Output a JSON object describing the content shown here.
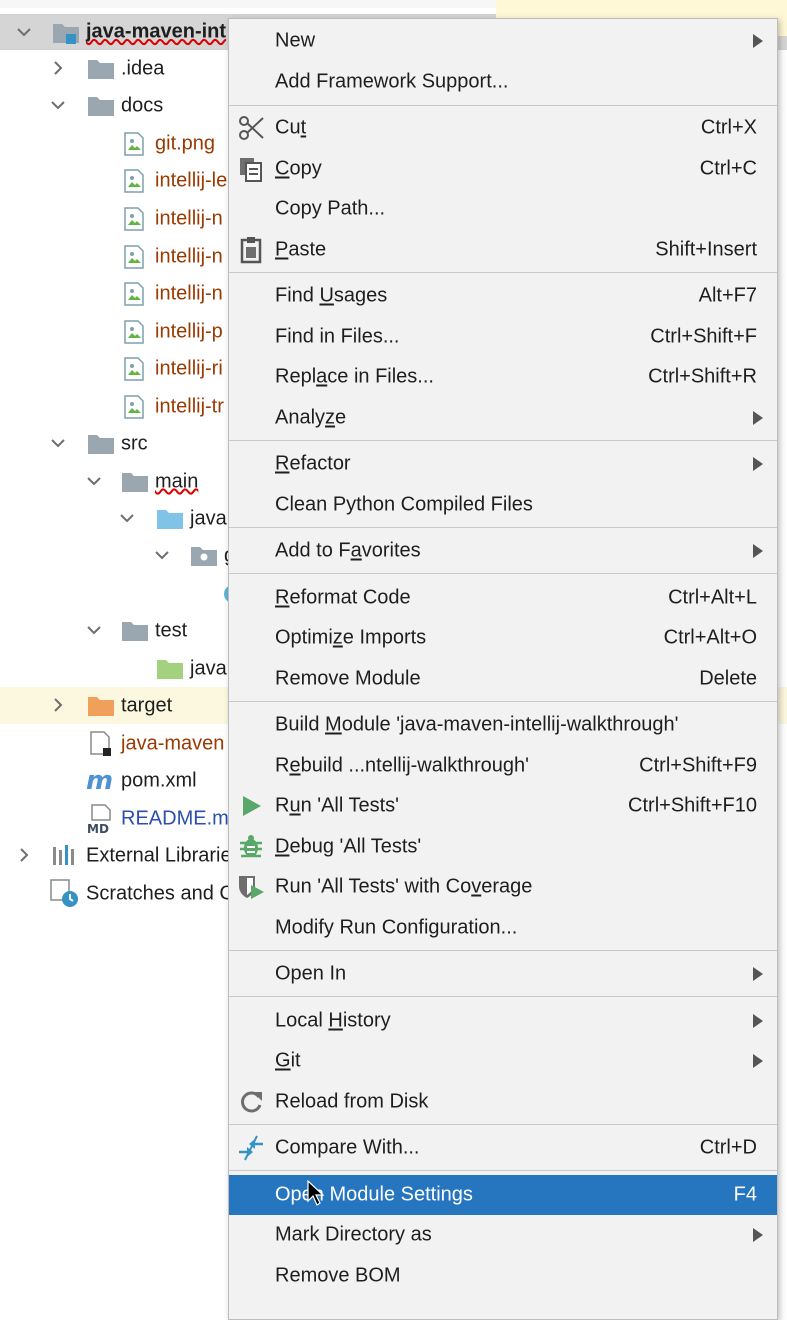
{
  "project_tree": {
    "root": {
      "name": "java-maven-int"
    },
    "items": [
      {
        "name": ".idea"
      },
      {
        "name": "docs"
      },
      {
        "name": "git.png"
      },
      {
        "name": "intellij-le"
      },
      {
        "name": "intellij-n"
      },
      {
        "name": "intellij-n"
      },
      {
        "name": "intellij-n"
      },
      {
        "name": "intellij-p"
      },
      {
        "name": "intellij-ri"
      },
      {
        "name": "intellij-tr"
      },
      {
        "name": "src"
      },
      {
        "name": "main"
      },
      {
        "name": "java"
      },
      {
        "name": "g"
      },
      {
        "name": "test"
      },
      {
        "name": "java"
      },
      {
        "name": "target"
      },
      {
        "name": "java-maven"
      },
      {
        "name": "pom.xml"
      },
      {
        "name": "README.m"
      },
      {
        "name": "External Librarie"
      },
      {
        "name": "Scratches and C"
      }
    ]
  },
  "context_menu": {
    "items": [
      {
        "label": "New",
        "shortcut": ""
      },
      {
        "label": "Add Framework Support...",
        "shortcut": ""
      },
      {
        "pre": "Cu",
        "u": "t",
        "post": "",
        "shortcut": "Ctrl+X"
      },
      {
        "pre": "",
        "u": "C",
        "post": "opy",
        "shortcut": "Ctrl+C"
      },
      {
        "label": "Copy Path...",
        "shortcut": ""
      },
      {
        "pre": "",
        "u": "P",
        "post": "aste",
        "shortcut": "Shift+Insert"
      },
      {
        "pre": "Find ",
        "u": "U",
        "post": "sages",
        "shortcut": "Alt+F7"
      },
      {
        "label": "Find in Files...",
        "shortcut": "Ctrl+Shift+F"
      },
      {
        "pre": "Repl",
        "u": "a",
        "post": "ce in Files...",
        "shortcut": "Ctrl+Shift+R"
      },
      {
        "pre": "Analy",
        "u": "z",
        "post": "e",
        "shortcut": ""
      },
      {
        "pre": "",
        "u": "R",
        "post": "efactor",
        "shortcut": ""
      },
      {
        "label": "Clean Python Compiled Files",
        "shortcut": ""
      },
      {
        "pre": "Add to F",
        "u": "a",
        "post": "vorites",
        "shortcut": ""
      },
      {
        "pre": "",
        "u": "R",
        "post": "eformat Code",
        "shortcut": "Ctrl+Alt+L"
      },
      {
        "pre": "Optimi",
        "u": "z",
        "post": "e Imports",
        "shortcut": "Ctrl+Alt+O"
      },
      {
        "label": "Remove Module",
        "shortcut": "Delete"
      },
      {
        "pre": "Build ",
        "u": "M",
        "post": "odule 'java-maven-intellij-walkthrough'",
        "shortcut": ""
      },
      {
        "pre": "R",
        "u": "e",
        "post": "build ...ntellij-walkthrough'",
        "shortcut": "Ctrl+Shift+F9"
      },
      {
        "pre": "R",
        "u": "u",
        "post": "n 'All Tests'",
        "shortcut": "Ctrl+Shift+F10"
      },
      {
        "pre": "",
        "u": "D",
        "post": "ebug 'All Tests'",
        "shortcut": ""
      },
      {
        "pre": "Run 'All Tests' with Co",
        "u": "v",
        "post": "erage",
        "shortcut": ""
      },
      {
        "label": "Modify Run Configuration...",
        "shortcut": ""
      },
      {
        "label": "Open In",
        "shortcut": ""
      },
      {
        "pre": "Local ",
        "u": "H",
        "post": "istory",
        "shortcut": ""
      },
      {
        "pre": "",
        "u": "G",
        "post": "it",
        "shortcut": ""
      },
      {
        "label": "Reload from Disk",
        "shortcut": ""
      },
      {
        "label": "Compare With...",
        "shortcut": "Ctrl+D"
      },
      {
        "label": "Open Module Settings",
        "shortcut": "F4"
      },
      {
        "label": "Mark Directory as",
        "shortcut": ""
      },
      {
        "label": "Remove BOM",
        "shortcut": ""
      }
    ]
  },
  "colors": {
    "selection": "#2675bf",
    "menu_bg": "#f2f2f2",
    "folder": "#9aa7b0",
    "excluded_folder": "#f0a05a",
    "java_folder": "#7fc4e6",
    "test_folder": "#a4d17d"
  }
}
